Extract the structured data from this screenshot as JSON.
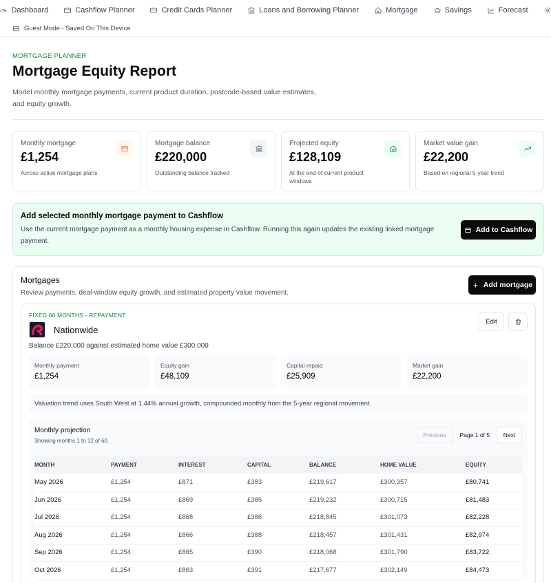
{
  "nav": {
    "items": [
      {
        "label": "Dashboard",
        "icon": "gauge-icon"
      },
      {
        "label": "Cashflow Planner",
        "icon": "wallet-icon"
      },
      {
        "label": "Credit Cards Planner",
        "icon": "credit-card-icon"
      },
      {
        "label": "Loans and Borrowing Planner",
        "icon": "bank-icon"
      },
      {
        "label": "Mortgage",
        "icon": "home-icon"
      },
      {
        "label": "Savings",
        "icon": "piggy-bank-icon"
      },
      {
        "label": "Forecast",
        "icon": "chart-line-icon"
      }
    ],
    "settings_icon": "gear-icon"
  },
  "guest": {
    "label": "Guest Mode - Saved On This Device",
    "icon": "database-icon"
  },
  "header": {
    "eyebrow": "MORTGAGE PLANNER",
    "title": "Mortgage Equity Report",
    "description": "Model monthly mortgage payments, current product duration, postcode-based value estimates, and equity growth."
  },
  "stats": [
    {
      "label": "Monthly mortgage",
      "value": "£1,254",
      "sub": "Across active mortgage plans",
      "icon": "wallet-icon",
      "color": "#ea580c",
      "bg": "#fff7ed"
    },
    {
      "label": "Mortgage balance",
      "value": "£220,000",
      "sub": "Outstanding balance tracked",
      "icon": "bank-icon",
      "color": "#334155",
      "bg": "#f1f5f9"
    },
    {
      "label": "Projected equity",
      "value": "£128,109",
      "sub": "At the end of current product windows",
      "icon": "home-icon",
      "color": "#15803d",
      "bg": "#ecfdf3"
    },
    {
      "label": "Market value gain",
      "value": "£22,200",
      "sub": "Based on regional 5-year trend",
      "icon": "trending-up-icon",
      "color": "#15803d",
      "bg": "#ecfdf3"
    }
  ],
  "banner": {
    "title": "Add selected monthly mortgage payment to Cashflow",
    "description": "Use the current mortgage payment as a monthly housing expense in Cashflow. Running this again updates the existing linked mortgage payment.",
    "button": "Add to Cashflow"
  },
  "mortgages": {
    "title": "Mortgages",
    "description": "Review payments, deal-window equity growth, and estimated property value movement.",
    "add_button": "Add mortgage",
    "card": {
      "tag": "FIXED 60 MONTHS - REPAYMENT",
      "lender": "Nationwide",
      "summary": "Balance £220,000 against estimated home value £300,000",
      "edit": "Edit",
      "kpis": [
        {
          "label": "Monthly payment",
          "value": "£1,254"
        },
        {
          "label": "Equity gain",
          "value": "£48,109"
        },
        {
          "label": "Capital repaid",
          "value": "£25,909"
        },
        {
          "label": "Market gain",
          "value": "£22,200"
        }
      ],
      "trend": "Valuation trend uses South West at 1.44% annual growth, compounded monthly from the 5-year regional movement.",
      "projection": {
        "title": "Monthly projection",
        "subtitle": "Showing months 1 to 12 of 60.",
        "prev": "Previous",
        "page": "Page 1 of 5",
        "next": "Next",
        "columns": [
          "MONTH",
          "PAYMENT",
          "INTEREST",
          "CAPITAL",
          "BALANCE",
          "HOME VALUE",
          "EQUITY"
        ],
        "rows": [
          [
            "May 2026",
            "£1,254",
            "£871",
            "£383",
            "£219,617",
            "£300,357",
            "£80,741"
          ],
          [
            "Jun 2026",
            "£1,254",
            "£869",
            "£385",
            "£219,232",
            "£300,715",
            "£81,483"
          ],
          [
            "Jul 2026",
            "£1,254",
            "£868",
            "£386",
            "£218,845",
            "£301,073",
            "£82,228"
          ],
          [
            "Aug 2026",
            "£1,254",
            "£866",
            "£388",
            "£218,457",
            "£301,431",
            "£82,974"
          ],
          [
            "Sep 2026",
            "£1,254",
            "£865",
            "£390",
            "£218,068",
            "£301,790",
            "£83,722"
          ],
          [
            "Oct 2026",
            "£1,254",
            "£863",
            "£391",
            "£217,677",
            "£302,149",
            "£84,473"
          ]
        ]
      }
    }
  }
}
